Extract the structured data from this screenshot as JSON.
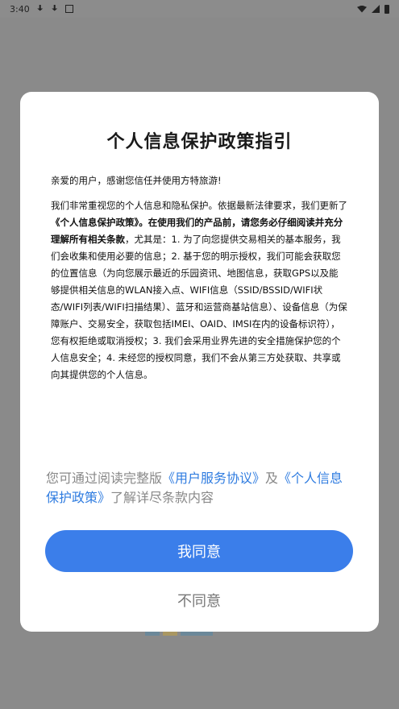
{
  "status_bar": {
    "time": "3:40"
  },
  "dialog": {
    "title": "个人信息保护政策指引",
    "greeting": "亲爱的用户，感谢您信任并使用方特旅游!",
    "body_part1": "我们非常重视您的个人信息和隐私保护。依据最新法律要求，我们更新了",
    "body_bold1": "《个人信息保护政策》。在使用我们的产品前，请您务必仔细阅读并充分理解所有相关条款",
    "body_part2": "，尤其是：1. 为了向您提供交易相关的基本服务，我们会收集和使用必要的信息；2. 基于您的明示授权，我们可能会获取您的位置信息（为向您展示最近的乐园资讯、地图信息，获取GPS以及能够提供相关信息的WLAN接入点、WIFI信息（SSID/BSSID/WIFI状态/WIFI列表/WIFI扫描结果）、蓝牙和运营商基站信息）、设备信息（为保障账户、交易安全，获取包括IMEI、OAID、IMSI在内的设备标识符），您有权拒绝或取消授权；3. 我们会采用业界先进的安全措施保护您的个人信息安全；4. 未经您的授权同意，我们不会从第三方处获取、共享或向其提供您的个人信息。",
    "note_prefix": "您可通过阅读完整版",
    "link_service": "《用户服务协议》",
    "note_and": "及",
    "link_privacy": "《个人信息保护政策》",
    "note_suffix": "了解详尽条款内容",
    "agree_label": "我同意",
    "disagree_label": "不同意"
  },
  "colors": {
    "accent": "#3b7eea",
    "link": "#2f7ce0",
    "overlay": "#8a8a8a"
  }
}
